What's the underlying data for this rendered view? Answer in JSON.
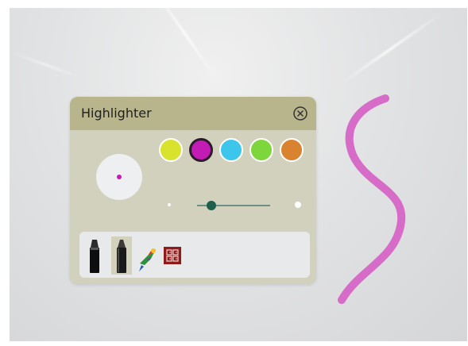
{
  "panel": {
    "title": "Highlighter",
    "close_icon": "close-circle-icon",
    "selected_color": "#c21cb4",
    "colors": [
      {
        "name": "yellow",
        "hex": "#d9e32e",
        "selected": false
      },
      {
        "name": "magenta",
        "hex": "#c21cb4",
        "selected": true
      },
      {
        "name": "sky-blue",
        "hex": "#3cc6ec",
        "selected": false
      },
      {
        "name": "green",
        "hex": "#7ed63d",
        "selected": false
      },
      {
        "name": "orange",
        "hex": "#d9822f",
        "selected": false
      }
    ],
    "size_level": 0.2,
    "tools": [
      {
        "name": "pen",
        "icon": "marker-pen-icon",
        "selected": false
      },
      {
        "name": "highlighter",
        "icon": "highlighter-icon",
        "selected": true
      },
      {
        "name": "artistic-brush",
        "icon": "bird-brush-icon",
        "selected": false
      },
      {
        "name": "pattern-brush",
        "icon": "pattern-icon",
        "selected": false
      }
    ]
  },
  "canvas": {
    "stroke_color": "#d66cc8"
  }
}
